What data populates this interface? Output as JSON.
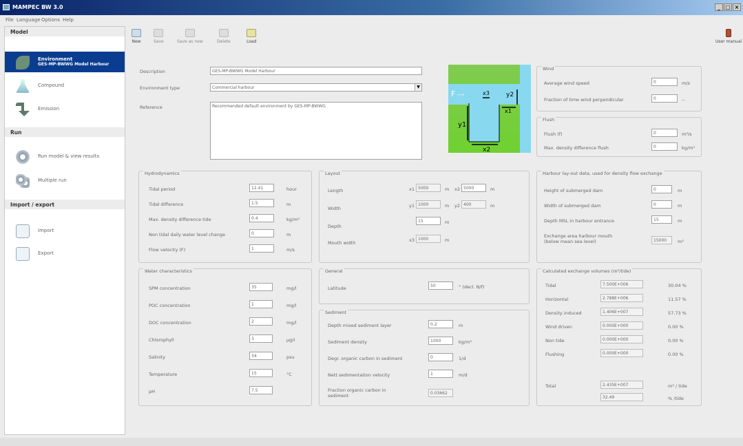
{
  "window": {
    "title": "MAMPEC BW 3.0"
  },
  "menu": [
    "File",
    "Language",
    "Options",
    "Help"
  ],
  "sidebar": {
    "model_header": "Model",
    "env_label": "Environment",
    "env_sub": "GES-MP-BWWG Model Harbour",
    "compound": "Compound",
    "emission": "Emission",
    "run_header": "Run",
    "run_model": "Run model & view results",
    "multiple_run": "Multiple run",
    "ie_header": "Import / export",
    "import": "Import",
    "export": "Export"
  },
  "toolbar": {
    "new": "New",
    "save": "Save",
    "save_as": "Save as new",
    "delete": "Delete",
    "load": "Load",
    "user_manual": "User manual"
  },
  "env": {
    "description_label": "Description",
    "description_value": "GES-MP-BWWG Model Harbour",
    "type_label": "Environment type",
    "type_value": "Commercial harbour",
    "reference_label": "Reference",
    "reference_value": "Recommended default environment by GES-MP-BWWG"
  },
  "diagram": {
    "f": "F",
    "x3": "x3",
    "y2": "y2",
    "x1": "x1",
    "y1": "y1",
    "x2": "x2"
  },
  "wind": {
    "title": "Wind",
    "avg_label": "Average wind speed",
    "avg_value": "0",
    "avg_unit": "m/s",
    "frac_label": "Fraction of time wind perpendicular",
    "frac_value": "0",
    "frac_unit": "--"
  },
  "flush": {
    "title": "Flush",
    "flush_label": "Flush (f)",
    "flush_value": "0",
    "flush_unit": "m³/s",
    "maxd_label": "Max. density difference flush",
    "maxd_value": "0",
    "maxd_unit": "kg/m³"
  },
  "hydro": {
    "title": "Hydrodynamics",
    "rows": [
      {
        "label": "Tidal period",
        "value": "12.41",
        "unit": "hour"
      },
      {
        "label": "Tidal difference",
        "value": "1.5",
        "unit": "m"
      },
      {
        "label": "Max. density difference tide",
        "value": "0.4",
        "unit": "kg/m³"
      },
      {
        "label": "Non tidal daily water level change",
        "value": "0",
        "unit": "m"
      },
      {
        "label": "Flow velocity (F)",
        "value": "1",
        "unit": "m/s"
      }
    ]
  },
  "layout": {
    "title": "Layout",
    "length_label": "Length",
    "x1_tag": "x1",
    "x1_value": "5000",
    "x2_tag": "x2",
    "x2_value": "5000",
    "m": "m",
    "width_label": "Width",
    "y1_tag": "y1",
    "y1_value": "1000",
    "y2_tag": "y2",
    "y2_value": "400",
    "depth_label": "Depth",
    "depth_value": "15",
    "mouth_label": "Mouth width",
    "x3_tag": "x3",
    "x3_value": "1000"
  },
  "harbour": {
    "title": "Harbour lay-out data, used for density flow exchange",
    "rows": [
      {
        "label": "Height of submerged dam",
        "value": "0",
        "unit": "m"
      },
      {
        "label": "Width of submerged dam",
        "value": "0",
        "unit": "m"
      },
      {
        "label": "Depth MSL in harbour entrance",
        "value": "15",
        "unit": "m"
      }
    ],
    "exch_label_1": "Exchange area harbour mouth",
    "exch_label_2": "(below mean sea level)",
    "exch_value": "15000",
    "exch_unit": "m²"
  },
  "water": {
    "title": "Water characteristics",
    "rows": [
      {
        "label": "SPM concentration",
        "value": "35",
        "unit": "mg/l"
      },
      {
        "label": "POC concentration",
        "value": "1",
        "unit": "mg/l"
      },
      {
        "label": "DOC concentration",
        "value": "2",
        "unit": "mg/l"
      },
      {
        "label": "Chlorophyll",
        "value": "3",
        "unit": "µg/l"
      },
      {
        "label": "Salinity",
        "value": "34",
        "unit": "psu"
      },
      {
        "label": "Temperature",
        "value": "15",
        "unit": "°C"
      },
      {
        "label": "pH",
        "value": "7.5",
        "unit": ""
      }
    ]
  },
  "general": {
    "title": "General",
    "lat_label": "Latitude",
    "lat_value": "50",
    "lat_unit": "° (decl. N/f)"
  },
  "sediment": {
    "title": "Sediment",
    "rows": [
      {
        "label": "Depth mixed sediment layer",
        "value": "0.2",
        "unit": "m"
      },
      {
        "label": "Sediment density",
        "value": "1000",
        "unit": "kg/m³"
      },
      {
        "label": "Degr. organic carbon in sediment",
        "value": "0",
        "unit": "1/d"
      },
      {
        "label": "Nett sedimentation velocity",
        "value": "1",
        "unit": "m/d"
      }
    ],
    "frac_label_1": "Fraction organic carbon in",
    "frac_label_2": "sediment",
    "frac_value": "0.03662"
  },
  "calc": {
    "title": "Calculated exchange volumes (m³/tide)",
    "rows": [
      {
        "label": "Tidal",
        "value": "7.500E+006",
        "pct": "30.04 %"
      },
      {
        "label": "Horizontal",
        "value": "2.788E+006",
        "pct": "11.57 %"
      },
      {
        "label": "Density induced",
        "value": "1.406E+007",
        "pct": "57.73 %"
      },
      {
        "label": "Wind driven",
        "value": "0.000E+000",
        "pct": "0.00 %"
      },
      {
        "label": "Non tide",
        "value": "0.000E+000",
        "pct": "0.00 %"
      },
      {
        "label": "Flushing",
        "value": "0.000E+000",
        "pct": "0.00 %"
      }
    ],
    "total_label": "Total",
    "total_value": "2.435E+007",
    "total_unit": "m³ / tide",
    "pct_value": "32.49",
    "pct_unit": "% /tide"
  }
}
